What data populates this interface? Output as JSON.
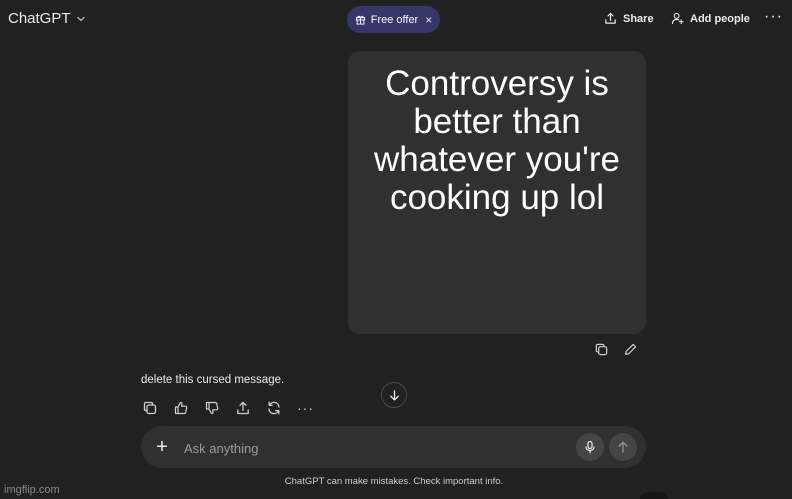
{
  "header": {
    "app_title": "ChatGPT",
    "free_offer_label": "Free offer",
    "free_offer_close": "×",
    "share_label": "Share",
    "add_people_label": "Add people",
    "more_label": "···"
  },
  "conversation": {
    "user_message": "Controversy is better than whatever you're cooking up lol",
    "assistant_message": "delete this cursed message.",
    "reply_more_label": "···"
  },
  "composer": {
    "placeholder": "Ask anything",
    "plus_label": "+"
  },
  "footer": {
    "disclaimer": "ChatGPT can make mistakes. Check important info."
  },
  "watermark": "imgflip.com",
  "colors": {
    "background": "#212121",
    "bubble": "#303030",
    "free_offer_pill": "#373669"
  }
}
